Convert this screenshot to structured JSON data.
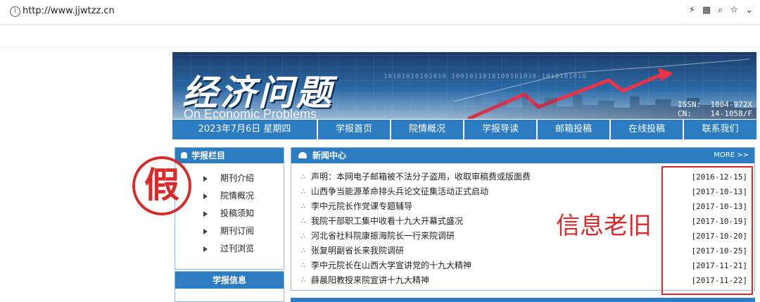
{
  "browser": {
    "url": "http://www.jjwtzz.cn",
    "info_icon": "info-icon",
    "icons": [
      "bolt-icon",
      "qr-icon",
      "zoom-icon",
      "star-icon",
      "chevron-down-icon"
    ]
  },
  "banner": {
    "title_cn": "经济问题",
    "title_en": "On Economic Problems",
    "issn": "ISSN:  1004-972X\nCN:    14-1058/F",
    "binary_text": "10101010101010  1001011010100101010  1010101010"
  },
  "nav": {
    "date": "2023年7月6日 星期四",
    "items": [
      "学报首页",
      "院情概况",
      "学报导读",
      "邮箱投稿",
      "在线投稿",
      "联系我们"
    ]
  },
  "left": {
    "title": "学报栏目",
    "menu": [
      "期刊介绍",
      "院情概况",
      "投稿须知",
      "期刊订阅",
      "过刊浏览"
    ],
    "title2": "学报信息"
  },
  "stamp": "假",
  "news": {
    "title": "新闻中心",
    "more": "MORE >>",
    "items": [
      {
        "text": "声明：本网电子邮箱被不法分子盗用，收取审稿费或版面费",
        "date": "[2016-12-15]"
      },
      {
        "text": "山西争当能源革命排头兵论文征集活动正式启动",
        "date": "[2017-10-13]"
      },
      {
        "text": "李中元院长作党课专题辅导",
        "date": "[2017-10-13]"
      },
      {
        "text": "我院干部职工集中收看十九大开幕式盛况",
        "date": "[2017-10-19]"
      },
      {
        "text": "河北省社科院康振海院长一行来院调研",
        "date": "[2017-10-20]"
      },
      {
        "text": "张复明副省长来我院调研",
        "date": "[2017-10-25]"
      },
      {
        "text": "李中元院长在山西大学宣讲党的十九大精神",
        "date": "[2017-11-21]"
      },
      {
        "text": "薛晨阳教授来院宣讲十九大精神",
        "date": "[2017-11-22]"
      }
    ]
  },
  "annotation": "信息老旧",
  "colors": {
    "nav_blue": "#2c7cc1",
    "accent_red": "#d92a2a"
  }
}
